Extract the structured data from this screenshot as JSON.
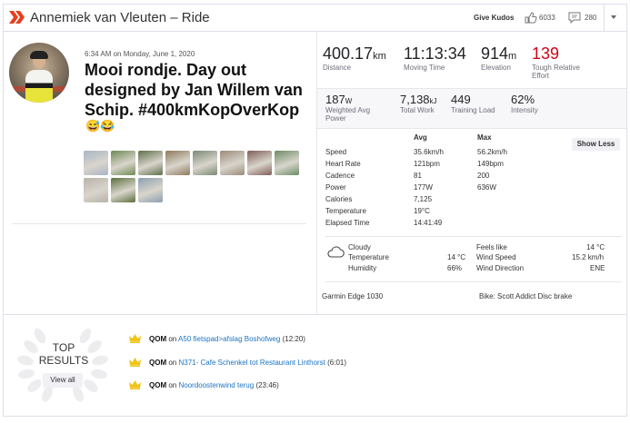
{
  "header": {
    "title": "Annemiek van Vleuten – Ride",
    "give_kudos": "Give Kudos",
    "kudos_count": "6033",
    "comment_count": "280"
  },
  "activity": {
    "datetime": "6:34 AM on Monday, June 1, 2020",
    "title": "Mooi rondje. Day out designed by Jan Willem van Schip. #400kmKopOverKop",
    "emoji": "😅😂"
  },
  "photos": [
    {
      "color": "#a9b5c4"
    },
    {
      "color": "#6f8a55"
    },
    {
      "color": "#5f6e4a"
    },
    {
      "color": "#8e7a5f"
    },
    {
      "color": "#7a8a76"
    },
    {
      "color": "#9b8b7a"
    },
    {
      "color": "#7f5e58"
    },
    {
      "color": "#6b8c66"
    },
    {
      "color": "#b8b2a8"
    },
    {
      "color": "#5c6f3e"
    },
    {
      "color": "#8ba0b0"
    }
  ],
  "primary_stats": [
    {
      "value": "400.17",
      "unit": "km",
      "label": "Distance"
    },
    {
      "value": "11:13:34",
      "unit": "",
      "label": "Moving Time"
    },
    {
      "value": "914",
      "unit": "m",
      "label": "Elevation"
    },
    {
      "value": "139",
      "unit": "",
      "label": "Tough Relative Effort"
    }
  ],
  "secondary_stats": [
    {
      "value": "187",
      "unit": "W",
      "label": "Weighted Avg Power"
    },
    {
      "value": "7,138",
      "unit": "kJ",
      "label": "Total Work"
    },
    {
      "value": "449",
      "unit": "",
      "label": "Training Load"
    },
    {
      "value": "62%",
      "unit": "",
      "label": "Intensity"
    }
  ],
  "details_table": {
    "col_avg": "Avg",
    "col_max": "Max",
    "show_less": "Show Less",
    "rows": [
      {
        "label": "Speed",
        "avg": "35.6km/h",
        "max": "56.2km/h"
      },
      {
        "label": "Heart Rate",
        "avg": "121bpm",
        "max": "149bpm"
      },
      {
        "label": "Cadence",
        "avg": "81",
        "max": "200"
      },
      {
        "label": "Power",
        "avg": "177W",
        "max": "636W"
      },
      {
        "label": "Calories",
        "avg": "7,125",
        "max": ""
      },
      {
        "label": "Temperature",
        "avg": "19°C",
        "max": ""
      },
      {
        "label": "Elapsed Time",
        "avg": "14:41:49",
        "max": ""
      }
    ]
  },
  "weather": {
    "condition": "Cloudy",
    "temperature_label": "Temperature",
    "temperature": "14 °C",
    "humidity_label": "Humidity",
    "humidity": "66%",
    "feels_like_label": "Feels like",
    "feels_like": "14 °C",
    "wind_speed_label": "Wind Speed",
    "wind_speed": "15.2 km/h",
    "wind_direction_label": "Wind Direction",
    "wind_direction": "ENE"
  },
  "equipment": {
    "device": "Garmin Edge 1030",
    "bike": "Bike: Scott Addict Disc brake"
  },
  "results": {
    "top_label": "TOP",
    "results_label": "RESULTS",
    "view_all": "View all",
    "items": [
      {
        "badge": "QOM",
        "on": "on",
        "segment": "A50 fietspad>afslag Boshofweg",
        "time": "(12:20)"
      },
      {
        "badge": "QOM",
        "on": "on",
        "segment": "N371- Cafe Schenkel tot Restaurant Linthorst",
        "time": "(6:01)"
      },
      {
        "badge": "QOM",
        "on": "on",
        "segment": "Noordoostenwind terug",
        "time": "(23:46)"
      }
    ]
  },
  "colors": {
    "brand": "#fc4c02",
    "link": "#1b74c6",
    "relative_effort": "#d0021b",
    "crown": "#f0c419"
  }
}
